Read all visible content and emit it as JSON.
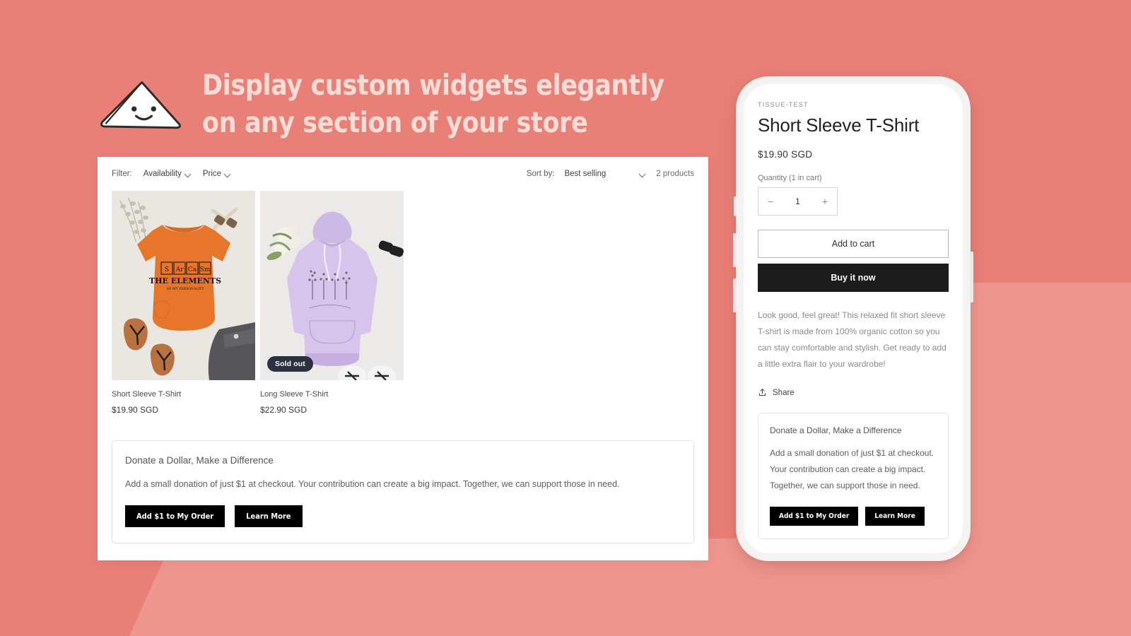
{
  "theme": {
    "background_color": "#e98077",
    "headline_color": "#fbdcd7",
    "accent_dark": "#000000",
    "badge_color": "#2c3142"
  },
  "headline": {
    "text": "Display custom widgets elegantly\non any section of your store",
    "mascot_icon": "smiling-triangle-logo-icon"
  },
  "collection_panel": {
    "filter_label": "Filter:",
    "filters": [
      {
        "label": "Availability",
        "icon": "chevron-down-icon"
      },
      {
        "label": "Price",
        "icon": "chevron-down-icon"
      }
    ],
    "sort_label": "Sort by:",
    "sort_value": "Best selling",
    "sort_icon": "chevron-down-icon",
    "product_count": "2 products",
    "products": [
      {
        "title": "Short Sleeve T-Shirt",
        "price": "$19.90 SGD",
        "badge": null,
        "image": "orange-tshirt-sarcasm-elements-flatlay"
      },
      {
        "title": "Long Sleeve T-Shirt",
        "price": "$22.90 SGD",
        "badge": "Sold out",
        "image": "lavender-hoodie-floral-flatlay"
      }
    ],
    "widget": {
      "title": "Donate a Dollar, Make a Difference",
      "body": "Add a small donation of just $1 at checkout. Your contribution can create a big impact. Together, we can support those in need.",
      "primary_button": "Add $1 to My Order",
      "secondary_button": "Learn More"
    }
  },
  "phone": {
    "vendor": "TISSUE-TEST",
    "product_title": "Short Sleeve T-Shirt",
    "price": "$19.90 SGD",
    "quantity_label": "Quantity (1 in cart)",
    "quantity_value": "1",
    "decrement_icon": "minus-icon",
    "increment_icon": "plus-icon",
    "add_to_cart": "Add to cart",
    "buy_it_now": "Buy it now",
    "description": "Look good, feel great! This relaxed fit short sleeve T-shirt is made from 100% organic cotton so you can stay comfortable and stylish. Get ready to add a little extra flair to your wardrobe!",
    "share_label": "Share",
    "share_icon": "share-upload-icon",
    "widget": {
      "title": "Donate a Dollar, Make a Difference",
      "body": "Add a small donation of just $1 at checkout. Your contribution can create a big impact. Together, we can support those in need.",
      "primary_button": "Add $1 to My Order",
      "secondary_button": "Learn More"
    }
  }
}
